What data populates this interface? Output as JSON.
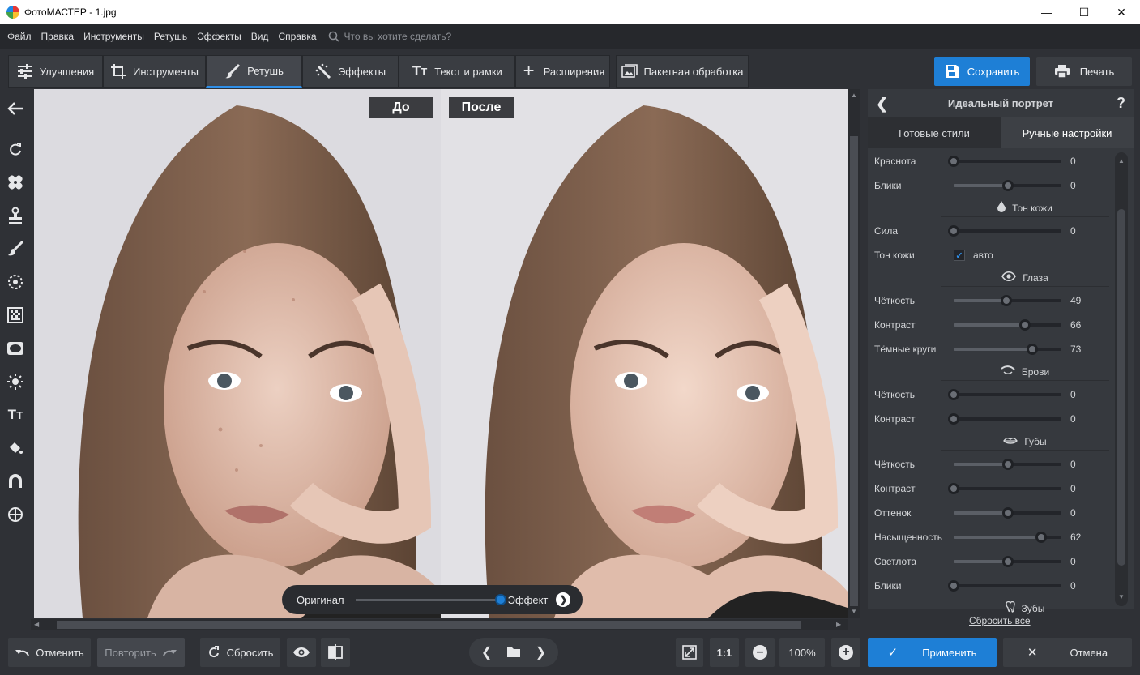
{
  "window": {
    "title": "ФотоМАСТЕР - 1.jpg"
  },
  "menu": {
    "items": [
      "Файл",
      "Правка",
      "Инструменты",
      "Ретушь",
      "Эффекты",
      "Вид",
      "Справка"
    ],
    "search_placeholder": "Что вы хотите сделать?"
  },
  "tabs": [
    {
      "label": "Улучшения",
      "icon": "sliders-icon"
    },
    {
      "label": "Инструменты",
      "icon": "crop-icon"
    },
    {
      "label": "Ретушь",
      "icon": "brush-icon",
      "active": true
    },
    {
      "label": "Эффекты",
      "icon": "sparkle-icon"
    },
    {
      "label": "Текст и рамки",
      "icon": "text-icon"
    },
    {
      "label": "Расширения",
      "icon": "plus-icon"
    }
  ],
  "batch_label": "Пакетная обработка",
  "save_label": "Сохранить",
  "print_label": "Печать",
  "canvas": {
    "before_label": "До",
    "after_label": "После",
    "compare": {
      "left": "Оригинал",
      "right": "Эффект",
      "value": 1.0
    }
  },
  "panel": {
    "title": "Идеальный портрет",
    "help": "?",
    "tabs": [
      "Готовые стили",
      "Ручные настройки"
    ],
    "active_tab": 1,
    "rows": [
      {
        "type": "slider",
        "label": "Краснота",
        "value": 0,
        "pos": 0.0
      },
      {
        "type": "slider",
        "label": "Блики",
        "value": 0,
        "pos": 0.5
      },
      {
        "type": "section",
        "label": "Тон кожи",
        "icon": "drop-icon"
      },
      {
        "type": "slider",
        "label": "Сила",
        "value": 0,
        "pos": 0.0
      },
      {
        "type": "check",
        "label": "Тон кожи",
        "check_label": "авто",
        "checked": true
      },
      {
        "type": "section",
        "label": "Глаза",
        "icon": "eye-icon"
      },
      {
        "type": "slider",
        "label": "Чёткость",
        "value": 49,
        "pos": 0.49
      },
      {
        "type": "slider",
        "label": "Контраст",
        "value": 66,
        "pos": 0.66
      },
      {
        "type": "slider",
        "label": "Тёмные круги",
        "value": 73,
        "pos": 0.73
      },
      {
        "type": "section",
        "label": "Брови",
        "icon": "brow-icon"
      },
      {
        "type": "slider",
        "label": "Чёткость",
        "value": 0,
        "pos": 0.0
      },
      {
        "type": "slider",
        "label": "Контраст",
        "value": 0,
        "pos": 0.0
      },
      {
        "type": "section",
        "label": "Губы",
        "icon": "lips-icon"
      },
      {
        "type": "slider",
        "label": "Чёткость",
        "value": 0,
        "pos": 0.5
      },
      {
        "type": "slider",
        "label": "Контраст",
        "value": 0,
        "pos": 0.0
      },
      {
        "type": "slider",
        "label": "Оттенок",
        "value": 0,
        "pos": 0.5
      },
      {
        "type": "slider",
        "label": "Насыщенность",
        "value": 62,
        "pos": 0.81
      },
      {
        "type": "slider",
        "label": "Светлота",
        "value": 0,
        "pos": 0.5
      },
      {
        "type": "slider",
        "label": "Блики",
        "value": 0,
        "pos": 0.0
      },
      {
        "type": "section",
        "label": "Зубы",
        "icon": "tooth-icon"
      }
    ],
    "reset_all": "Сбросить все"
  },
  "bottom": {
    "undo": "Отменить",
    "redo": "Повторить",
    "reset": "Сбросить",
    "zoom_fit": "1:1",
    "zoom": "100%",
    "apply": "Применить",
    "cancel": "Отмена"
  },
  "colors": {
    "accent": "#1e7fd6",
    "bg": "#2f3136",
    "panel": "#36393e"
  }
}
